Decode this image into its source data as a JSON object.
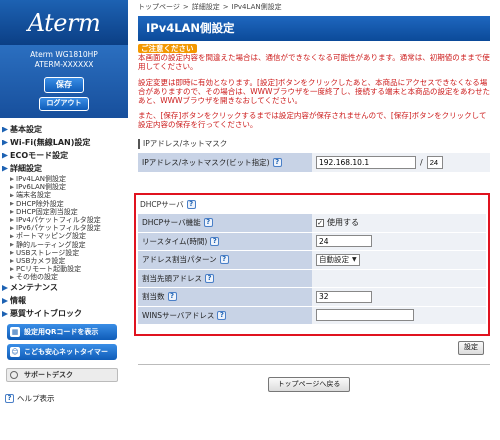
{
  "sidebar": {
    "logo": "Aterm",
    "model_name": "Aterm WG1810HP",
    "model_id": "ATERM-XXXXXX",
    "save_label": "保存",
    "logout_label": "ログアウト",
    "nav": [
      {
        "label": "基本設定",
        "type": "main"
      },
      {
        "label": "Wi-Fi(無線LAN)設定",
        "type": "main"
      },
      {
        "label": "ECOモード設定",
        "type": "main"
      },
      {
        "label": "詳細設定",
        "type": "main"
      },
      {
        "label": "IPv4LAN側設定",
        "type": "sub"
      },
      {
        "label": "IPv6LAN側設定",
        "type": "sub"
      },
      {
        "label": "端末名設定",
        "type": "sub"
      },
      {
        "label": "DHCP除外設定",
        "type": "sub"
      },
      {
        "label": "DHCP固定割当設定",
        "type": "sub"
      },
      {
        "label": "IPv4パケットフィルタ設定",
        "type": "sub"
      },
      {
        "label": "IPv6パケットフィルタ設定",
        "type": "sub"
      },
      {
        "label": "ポートマッピング設定",
        "type": "sub"
      },
      {
        "label": "静的ルーティング設定",
        "type": "sub"
      },
      {
        "label": "USBストレージ設定",
        "type": "sub"
      },
      {
        "label": "USBカメラ設定",
        "type": "sub"
      },
      {
        "label": "PCリモート起動設定",
        "type": "sub"
      },
      {
        "label": "その他の設定",
        "type": "sub"
      },
      {
        "label": "メンテナンス",
        "type": "main"
      },
      {
        "label": "情報",
        "type": "main"
      },
      {
        "label": "悪質サイトブロック",
        "type": "main"
      }
    ],
    "qr_label": "設定用QRコードを表示",
    "kodomo_label": "こども安心ネットタイマー",
    "support_label": "サポートデスク",
    "help_label": "ヘルプ表示"
  },
  "main": {
    "breadcrumb": [
      "トップページ",
      "詳細設定",
      "IPv4LAN側設定"
    ],
    "title": "IPv4LAN側設定",
    "caution": {
      "head": "ご注意ください",
      "p1": "本画面の設定内容を間違えた場合は、通信ができなくなる可能性があります。通常は、初期値のままで使用してください。",
      "p2": "設定変更は即時に有効となります。[設定]ボタンをクリックしたあと、本商品にアクセスできなくなる場合がありますので、その場合は、WWWブラウザを一度終了し、接続する端末と本商品の設定をあわせたあと、WWWブラウザを開きなおしてください。",
      "p3": "また、[保存]ボタンをクリックするまでは設定内容が保存されませんので、[保存]ボタンをクリックして設定内容の保存を行ってください。"
    },
    "ipmask_section": {
      "title": "IPアドレス/ネットマスク",
      "row_label": "IPアドレス/ネットマスク(ビット指定)",
      "ip_value": "192.168.10.1",
      "mask_value": "24"
    },
    "dhcp_section": {
      "title": "DHCPサーバ",
      "rows": {
        "server_label": "DHCPサーバ機能",
        "server_value": "使用する",
        "lease_label": "リースタイム(時間)",
        "lease_value": "24",
        "pattern_label": "アドレス割当パターン",
        "pattern_value": "自動設定",
        "start_label": "割当先頭アドレス",
        "count_label": "割当数",
        "count_value": "32",
        "wins_label": "WINSサーバアドレス",
        "wins_value": ""
      }
    },
    "set_label": "設定",
    "top_label": "トップページへ戻る"
  }
}
